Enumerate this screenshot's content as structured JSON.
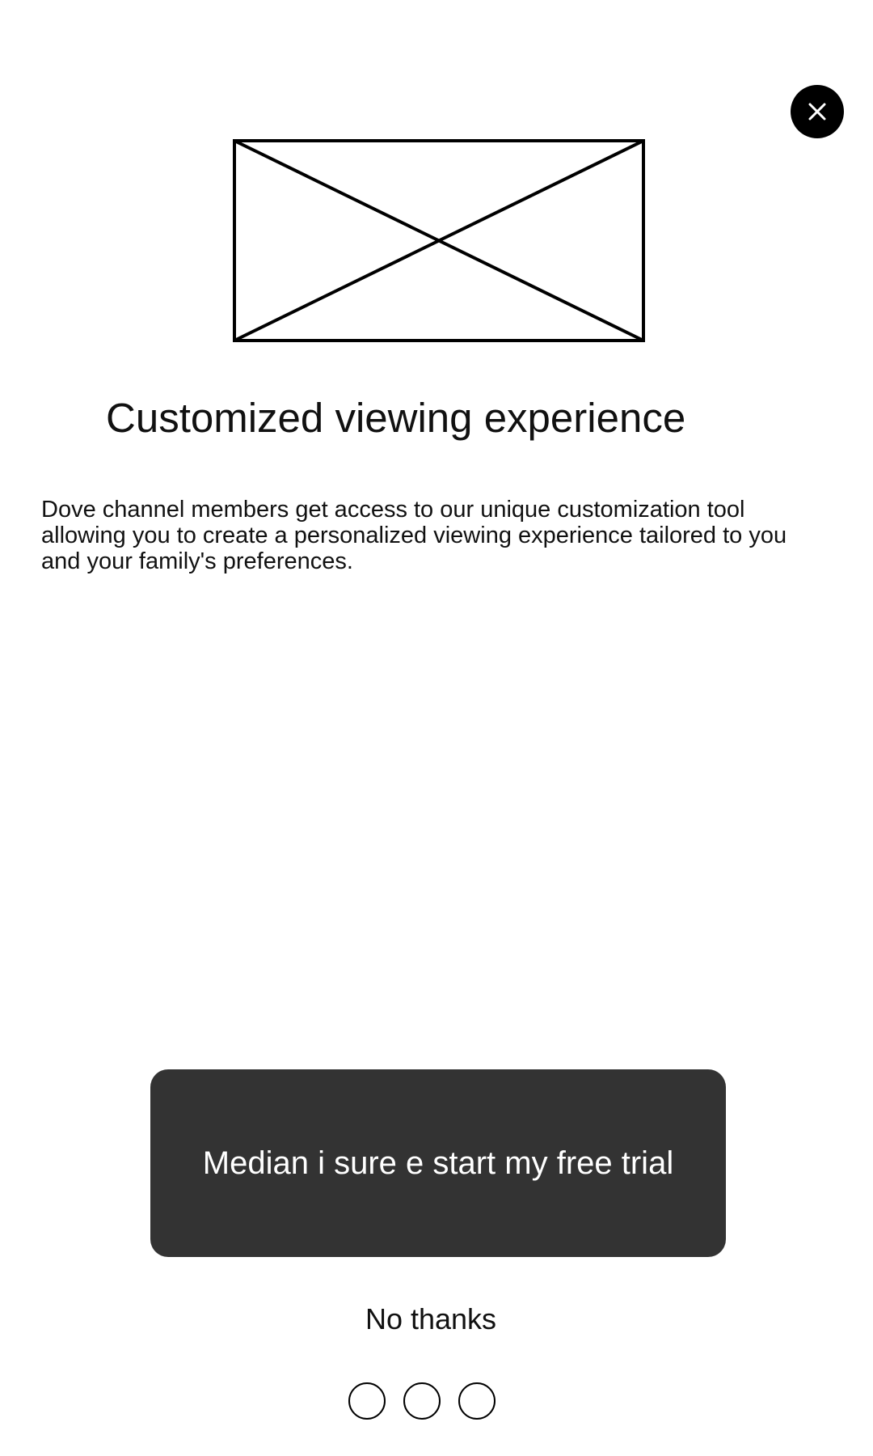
{
  "header": {
    "close_icon": "close-icon"
  },
  "hero": {
    "image_icon": "image-placeholder-icon"
  },
  "content": {
    "title": "Customized viewing experience",
    "description": "Dove channel members get access to our unique customization tool allowing you to create a personalized viewing experience tailored to you and your family's preferences."
  },
  "actions": {
    "primary_label": "Median i sure e start my free trial",
    "secondary_label": "No thanks"
  },
  "pagination": {
    "page_count": 3
  },
  "colors": {
    "button_background": "#333333",
    "close_background": "#000000"
  }
}
